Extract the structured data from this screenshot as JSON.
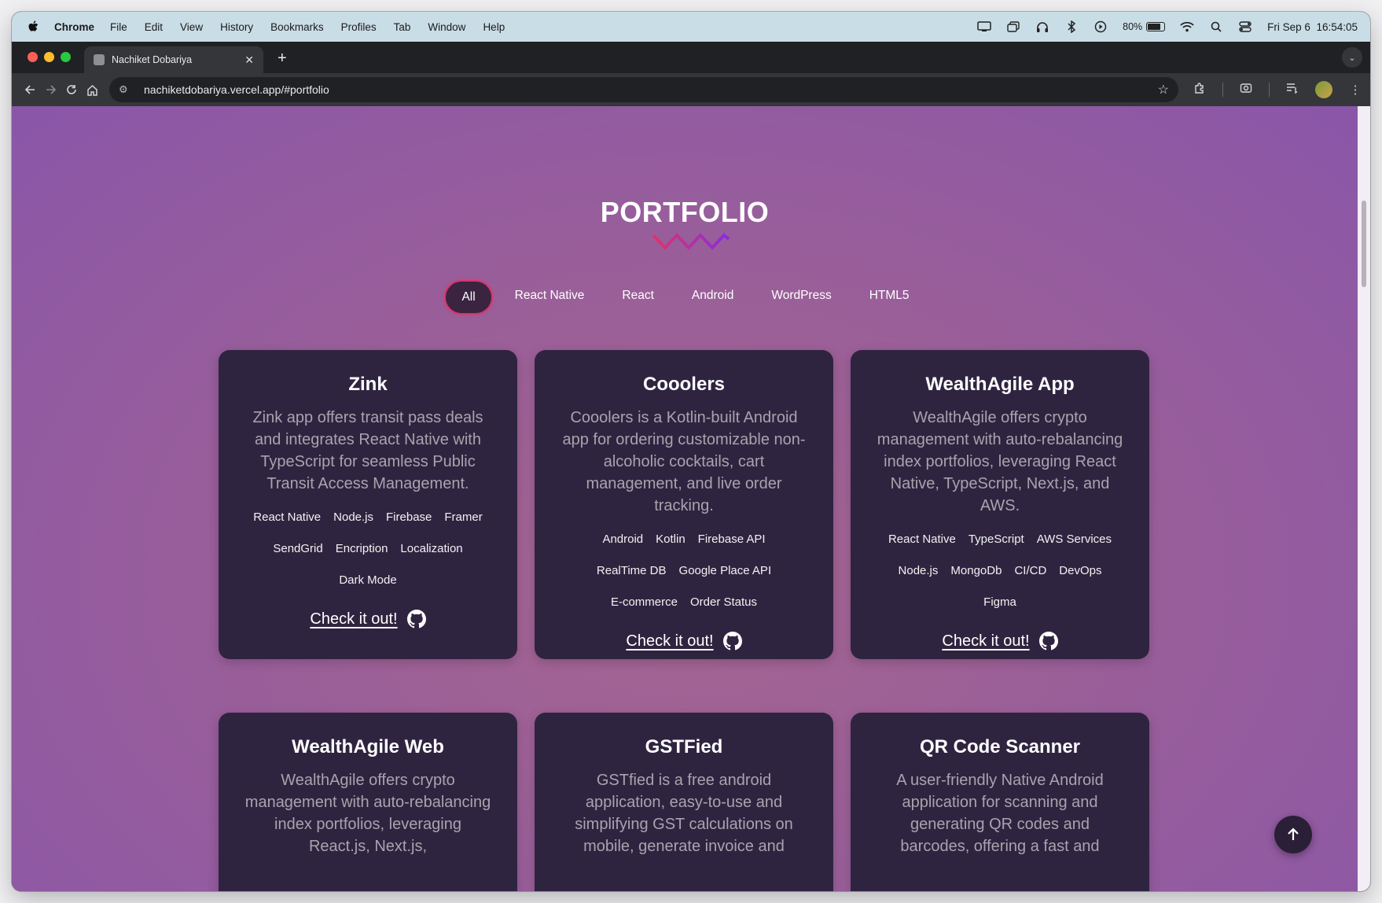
{
  "menubar": {
    "app": "Chrome",
    "items": [
      "File",
      "Edit",
      "View",
      "History",
      "Bookmarks",
      "Profiles",
      "Tab",
      "Window",
      "Help"
    ],
    "battery": "80%",
    "datetime": "Fri Sep 6  16:54:05"
  },
  "browser": {
    "tab_title": "Nachiket Dobariya",
    "url": "nachiketdobariya.vercel.app/#portfolio"
  },
  "page": {
    "title": "PORTFOLIO",
    "filters": [
      "All",
      "React Native",
      "React",
      "Android",
      "WordPress",
      "HTML5"
    ],
    "active_filter": "All",
    "check_label": "Check it out!",
    "projects": [
      {
        "name": "Zink",
        "description": "Zink app offers transit pass deals and integrates React Native with TypeScript for seamless Public Transit Access Management.",
        "tags": [
          "React Native",
          "Node.js",
          "Firebase",
          "Framer",
          "SendGrid",
          "Encription",
          "Localization",
          "Dark Mode"
        ]
      },
      {
        "name": "Cooolers",
        "description": "Cooolers is a Kotlin-built Android app for ordering customizable non-alcoholic cocktails, cart management, and live order tracking.",
        "tags": [
          "Android",
          "Kotlin",
          "Firebase API",
          "RealTime DB",
          "Google Place API",
          "E-commerce",
          "Order Status"
        ]
      },
      {
        "name": "WealthAgile App",
        "description": "WealthAgile offers crypto management with auto-rebalancing index portfolios, leveraging React Native, TypeScript, Next.js, and AWS.",
        "tags": [
          "React Native",
          "TypeScript",
          "AWS Services",
          "Node.js",
          "MongoDb",
          "CI/CD",
          "DevOps",
          "Figma"
        ]
      },
      {
        "name": "WealthAgile Web",
        "description": "WealthAgile offers crypto management with auto-rebalancing index portfolios, leveraging React.js, Next.js,",
        "tags": []
      },
      {
        "name": "GSTFied",
        "description": "GSTfied is a free android application, easy-to-use and simplifying GST calculations on mobile, generate invoice and",
        "tags": []
      },
      {
        "name": "QR Code Scanner",
        "description": "A user-friendly Native Android application for scanning and generating QR codes and barcodes, offering a fast and",
        "tags": []
      }
    ]
  },
  "colors": {
    "card_bg": "#2f2440",
    "accent_pink": "#d6346d",
    "accent_purple": "#8a2be2"
  }
}
